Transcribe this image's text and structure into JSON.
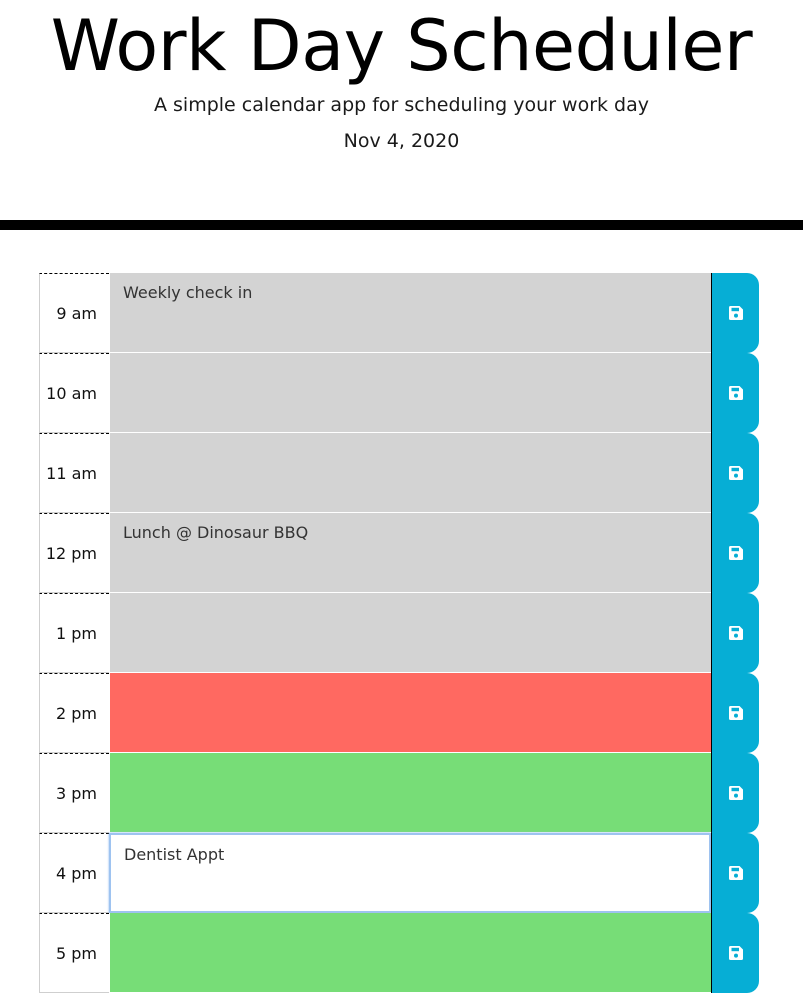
{
  "header": {
    "title": "Work Day Scheduler",
    "subtitle": "A simple calendar app for scheduling your work day",
    "current_date": "Nov 4, 2020"
  },
  "colors": {
    "past": "#d3d3d3",
    "present": "#ff6961",
    "future": "#77dd77",
    "save_button": "#06aed5"
  },
  "time_blocks": [
    {
      "hour": "9 am",
      "text": "Weekly check in",
      "state": "past"
    },
    {
      "hour": "10 am",
      "text": "",
      "state": "past"
    },
    {
      "hour": "11 am",
      "text": "",
      "state": "past"
    },
    {
      "hour": "12 pm",
      "text": "Lunch @ Dinosaur BBQ",
      "state": "past"
    },
    {
      "hour": "1 pm",
      "text": "",
      "state": "past"
    },
    {
      "hour": "2 pm",
      "text": "",
      "state": "present"
    },
    {
      "hour": "3 pm",
      "text": "",
      "state": "future"
    },
    {
      "hour": "4 pm",
      "text": "Dentist Appt",
      "state": "editing"
    },
    {
      "hour": "5 pm",
      "text": "",
      "state": "future"
    }
  ],
  "save_icon": "floppy-disk-icon"
}
